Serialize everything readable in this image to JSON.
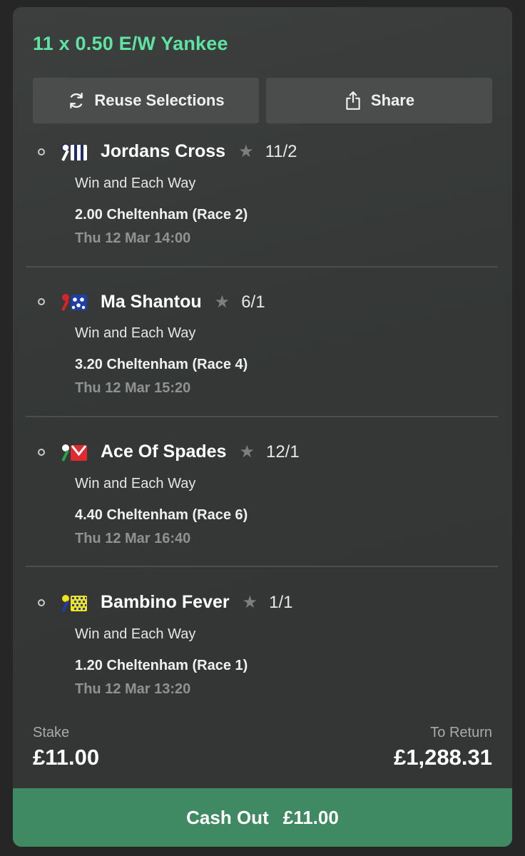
{
  "bet": {
    "title": "11 x 0.50 E/W Yankee"
  },
  "actions": {
    "reuse_label": "Reuse Selections",
    "share_label": "Share"
  },
  "selections": [
    {
      "runner": "Jordans Cross",
      "odds": "11/2",
      "market": "Win and Each Way",
      "race": "2.00 Cheltenham (Race 2)",
      "time": "Thu 12 Mar 14:00"
    },
    {
      "runner": "Ma Shantou",
      "odds": "6/1",
      "market": "Win and Each Way",
      "race": "3.20 Cheltenham (Race 4)",
      "time": "Thu 12 Mar 15:20"
    },
    {
      "runner": "Ace Of Spades",
      "odds": "12/1",
      "market": "Win and Each Way",
      "race": "4.40 Cheltenham (Race 6)",
      "time": "Thu 12 Mar 16:40"
    },
    {
      "runner": "Bambino Fever",
      "odds": "1/1",
      "market": "Win and Each Way",
      "race": "1.20 Cheltenham (Race 1)",
      "time": "Thu 12 Mar 13:20"
    }
  ],
  "summary": {
    "stake_label": "Stake",
    "stake_value": "£11.00",
    "return_label": "To Return",
    "return_value": "£1,288.31"
  },
  "cashout": {
    "label": "Cash Out",
    "amount": "£11.00"
  },
  "colors": {
    "accent_green": "#5fe3a3",
    "cashout_green": "#3f8a63",
    "card_bg": "#343736"
  }
}
